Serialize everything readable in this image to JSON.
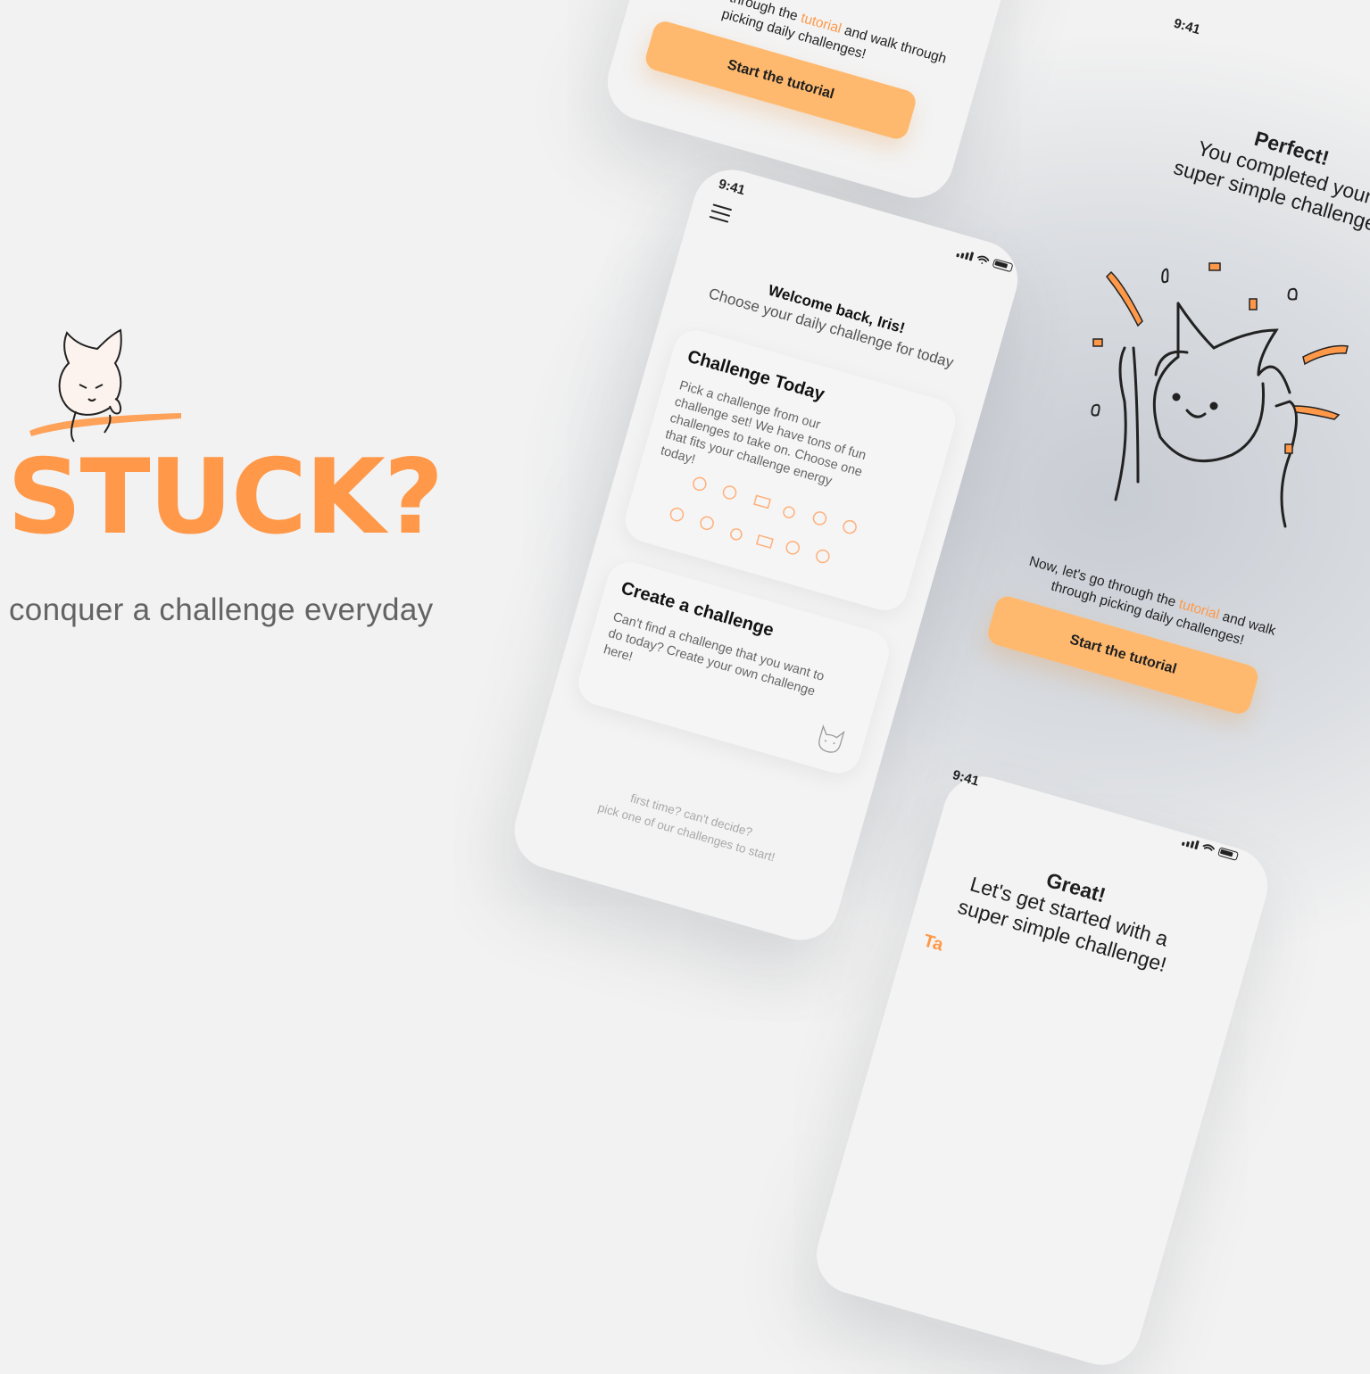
{
  "brand": {
    "title": "STUCK?",
    "tagline": "conquer a challenge everyday",
    "accent_color": "#ff9848",
    "mascot_icon": "thinking-cat-icon"
  },
  "top_screen": {
    "text_before": "Now, let's go through the",
    "tutorial_word": "tutorial",
    "text_after": "and walk through picking daily challenges!",
    "button_label": "Start the tutorial"
  },
  "main_screen": {
    "time": "9:41",
    "welcome": "Welcome back, Iris!",
    "subtitle": "Choose your daily challenge for today",
    "card_today": {
      "title": "Challenge Today",
      "body": "Pick a challenge from our challenge set! We have tons of fun challenges to take on. Choose one that fits your challenge energy today!"
    },
    "card_create": {
      "title": "Create a challenge",
      "body": "Can't find a challenge that you want to do today? Create your own challenge here!"
    },
    "footer_line1": "first time? can't decide?",
    "footer_line2": "pick one of our challenges to start!"
  },
  "right_screen": {
    "time": "9:41",
    "heading": "Perfect!",
    "line1": "You completed your",
    "line2": "super simple challenge!",
    "now_prefix": "Now, let's go through the",
    "tutorial_word": "tutorial",
    "now_suffix": "and walk through picking daily challenges!",
    "button_label": "Start the tutorial"
  },
  "bottom_screen": {
    "time": "9:41",
    "heading": "Great!",
    "line1": "Let's get started with a",
    "line2": "super simple challenge!",
    "cut_text": "Ta"
  }
}
